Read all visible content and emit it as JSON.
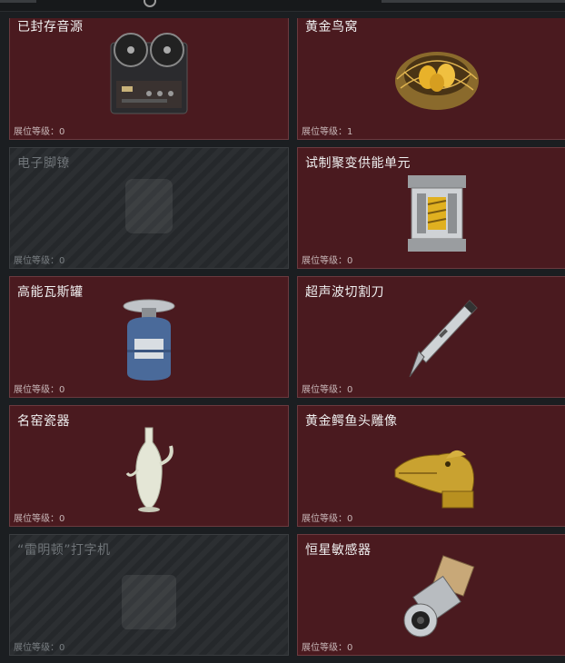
{
  "items": [
    {
      "name": "已封存音源",
      "level_label": "展位等级：",
      "level": "0",
      "locked": false,
      "icon": "reel-tape-recorder-icon"
    },
    {
      "name": "黄金鸟窝",
      "level_label": "展位等级：",
      "level": "1",
      "locked": false,
      "icon": "golden-nest-icon"
    },
    {
      "name": "电子脚镣",
      "level_label": "展位等级：",
      "level": "0",
      "locked": true,
      "icon": "electronic-anklet-icon"
    },
    {
      "name": "试制聚变供能单元",
      "level_label": "展位等级：",
      "level": "0",
      "locked": false,
      "icon": "fusion-power-unit-icon"
    },
    {
      "name": "高能瓦斯罐",
      "level_label": "展位等级：",
      "level": "0",
      "locked": false,
      "icon": "gas-canister-icon"
    },
    {
      "name": "超声波切割刀",
      "level_label": "展位等级：",
      "level": "0",
      "locked": false,
      "icon": "ultrasonic-cutter-icon"
    },
    {
      "name": "名窑瓷器",
      "level_label": "展位等级：",
      "level": "0",
      "locked": false,
      "icon": "porcelain-vase-icon"
    },
    {
      "name": "黄金鳄鱼头雕像",
      "level_label": "展位等级：",
      "level": "0",
      "locked": false,
      "icon": "golden-crocodile-head-icon"
    },
    {
      "name": "“雷明顿”打字机",
      "level_label": "展位等级：",
      "level": "0",
      "locked": true,
      "icon": "typewriter-icon"
    },
    {
      "name": "恒星敏感器",
      "level_label": "展位等级：",
      "level": "0",
      "locked": false,
      "icon": "star-sensor-icon"
    }
  ],
  "colors": {
    "card_bg": "#4a1a1f",
    "locked_bg": "#2c2f32",
    "page_bg": "#1b1e21"
  }
}
